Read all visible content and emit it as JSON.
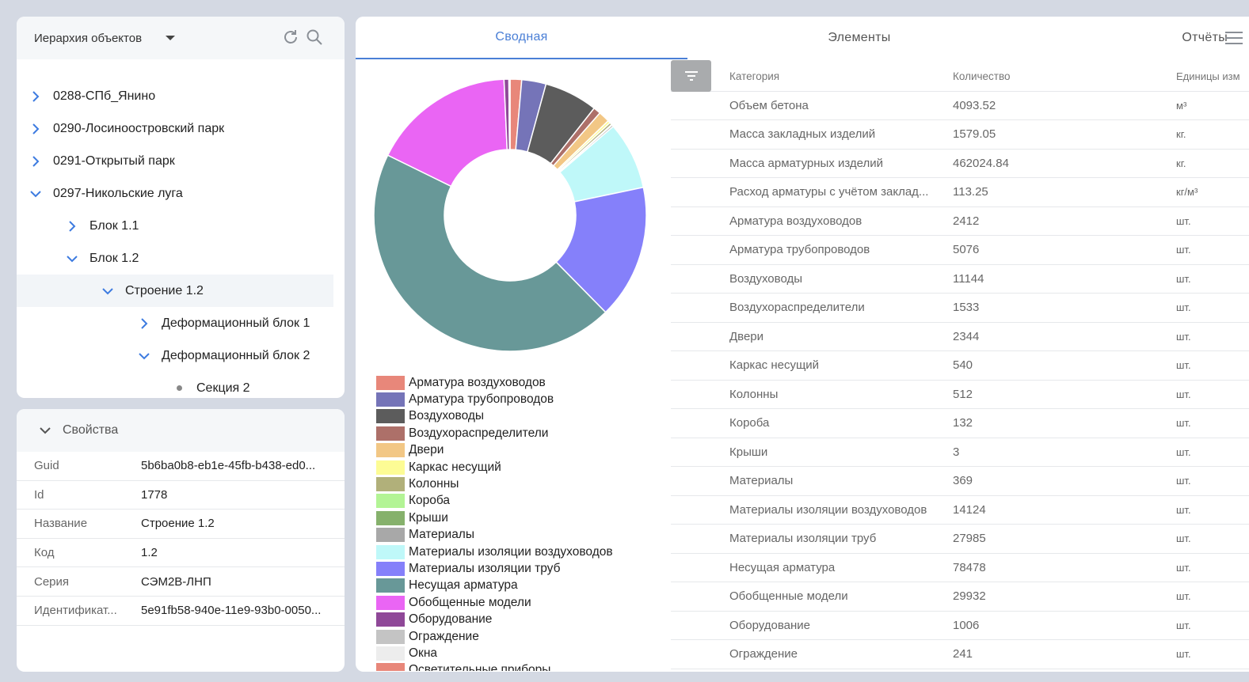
{
  "tree": {
    "header_label": "Иерархия объектов",
    "items": [
      {
        "label": "0288-СПб_Янино",
        "level": 0,
        "state": "collapsed"
      },
      {
        "label": "0290-Лосиноостровский парк",
        "level": 0,
        "state": "collapsed"
      },
      {
        "label": "0291-Открытый парк",
        "level": 0,
        "state": "collapsed"
      },
      {
        "label": "0297-Никольские луга",
        "level": 0,
        "state": "expanded"
      },
      {
        "label": "Блок 1.1",
        "level": 1,
        "state": "collapsed"
      },
      {
        "label": "Блок 1.2",
        "level": 1,
        "state": "expanded"
      },
      {
        "label": "Строение 1.2",
        "level": 2,
        "state": "expanded",
        "selected": true
      },
      {
        "label": "Деформационный блок 1",
        "level": 3,
        "state": "collapsed"
      },
      {
        "label": "Деформационный блок 2",
        "level": 3,
        "state": "expanded"
      },
      {
        "label": "Секция 2",
        "level": 4,
        "state": "leaf"
      }
    ]
  },
  "properties": {
    "header_label": "Свойства",
    "rows": [
      {
        "key": "Guid",
        "value": "5b6ba0b8-eb1e-45fb-b438-ed0..."
      },
      {
        "key": "Id",
        "value": "1778"
      },
      {
        "key": "Название",
        "value": "Строение 1.2"
      },
      {
        "key": "Код",
        "value": "1.2"
      },
      {
        "key": "Серия",
        "value": "СЭМ2В-ЛНП"
      },
      {
        "key": "Идентификат...",
        "value": "5e91fb58-940e-11e9-93b0-0050..."
      }
    ]
  },
  "tabs": {
    "summary": "Сводная",
    "elements": "Элементы",
    "reports": "Отчёты"
  },
  "table": {
    "headers": {
      "category": "Категория",
      "quantity": "Количество",
      "units": "Единицы изм"
    },
    "rows": [
      {
        "category": "Объем бетона",
        "quantity": "4093.52",
        "unit": "м³"
      },
      {
        "category": "Масса закладных изделий",
        "quantity": "1579.05",
        "unit": "кг."
      },
      {
        "category": "Масса арматурных изделий",
        "quantity": "462024.84",
        "unit": "кг."
      },
      {
        "category": "Расход арматуры с учётом заклад...",
        "quantity": "113.25",
        "unit": "кг/м³"
      },
      {
        "category": "Арматура воздуховодов",
        "quantity": "2412",
        "unit": "шт."
      },
      {
        "category": "Арматура трубопроводов",
        "quantity": "5076",
        "unit": "шт."
      },
      {
        "category": "Воздуховоды",
        "quantity": "11144",
        "unit": "шт."
      },
      {
        "category": "Воздухораспределители",
        "quantity": "1533",
        "unit": "шт."
      },
      {
        "category": "Двери",
        "quantity": "2344",
        "unit": "шт."
      },
      {
        "category": "Каркас несущий",
        "quantity": "540",
        "unit": "шт."
      },
      {
        "category": "Колонны",
        "quantity": "512",
        "unit": "шт."
      },
      {
        "category": "Короба",
        "quantity": "132",
        "unit": "шт."
      },
      {
        "category": "Крыши",
        "quantity": "3",
        "unit": "шт."
      },
      {
        "category": "Материалы",
        "quantity": "369",
        "unit": "шт."
      },
      {
        "category": "Материалы изоляции воздуховодов",
        "quantity": "14124",
        "unit": "шт."
      },
      {
        "category": "Материалы изоляции труб",
        "quantity": "27985",
        "unit": "шт."
      },
      {
        "category": "Несущая арматура",
        "quantity": "78478",
        "unit": "шт."
      },
      {
        "category": "Обобщенные модели",
        "quantity": "29932",
        "unit": "шт."
      },
      {
        "category": "Оборудование",
        "quantity": "1006",
        "unit": "шт."
      },
      {
        "category": "Ограждение",
        "quantity": "241",
        "unit": "шт."
      }
    ]
  },
  "chart_data": {
    "type": "pie",
    "donut": true,
    "categories": [
      "Арматура воздуховодов",
      "Арматура трубопроводов",
      "Воздуховоды",
      "Воздухораспределители",
      "Двери",
      "Каркас несущий",
      "Колонны",
      "Короба",
      "Крыши",
      "Материалы",
      "Материалы изоляции воздуховодов",
      "Материалы изоляции труб",
      "Несущая арматура",
      "Обобщенные модели",
      "Оборудование",
      "Ограждение",
      "Окна",
      "Осветительные приборы"
    ],
    "colors": [
      "#e8877a",
      "#7574b8",
      "#5c5c5c",
      "#ad7069",
      "#f2c785",
      "#fdfc95",
      "#b1b07a",
      "#b3f495",
      "#86b16c",
      "#a8a8a8",
      "#bff8f9",
      "#8580fa",
      "#689898",
      "#ea65f4",
      "#8f4898",
      "#c4c4c4",
      "#ededed",
      "#e8877a"
    ],
    "legend_position": "bottom"
  }
}
